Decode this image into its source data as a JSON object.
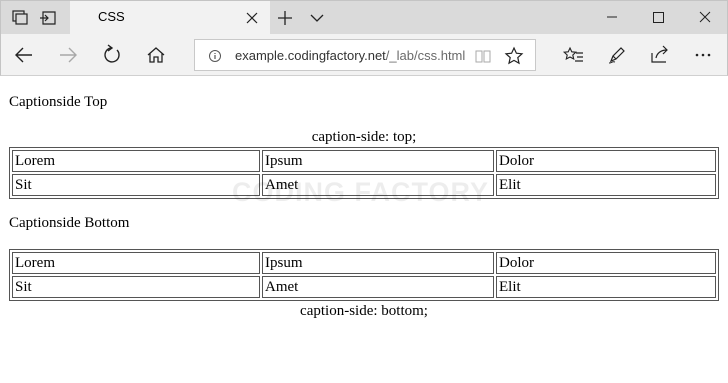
{
  "browser": {
    "tab_title": "CSS",
    "url_host": "example.codingfactory.net",
    "url_path": "/_lab/css.html"
  },
  "page": {
    "heading_top": "Captionside Top",
    "caption_top": "caption-side: top;",
    "heading_bottom": "Captionside Bottom",
    "caption_bottom": "caption-side: bottom;",
    "watermark": "CODING FACTORY",
    "table_rows": [
      [
        "Lorem",
        "Ipsum",
        "Dolor"
      ],
      [
        "Sit",
        "Amet",
        "Elit"
      ]
    ]
  },
  "icons": {
    "tab_actions": "tab-actions-icon",
    "set_aside": "set-tabs-aside-icon",
    "new_tab": "plus-icon",
    "tab_list": "chevron-down-icon",
    "minimize": "minimize-icon",
    "maximize": "maximize-icon",
    "close": "close-icon",
    "back": "back-arrow-icon",
    "forward": "forward-arrow-icon",
    "refresh": "refresh-icon",
    "home": "home-icon",
    "info": "info-icon",
    "reading_view": "book-icon",
    "favorite": "star-icon",
    "favorites_hub": "favorites-hub-icon",
    "notes": "pen-icon",
    "share": "share-icon",
    "more": "more-icon"
  }
}
